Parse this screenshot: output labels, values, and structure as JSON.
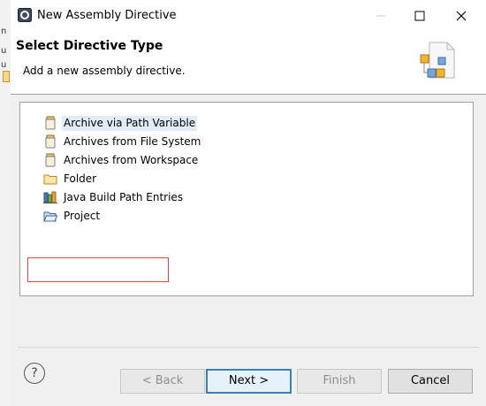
{
  "window": {
    "title": "New Assembly Directive"
  },
  "background_fragments": [
    "n",
    "u",
    "u"
  ],
  "header": {
    "title": "Select Directive Type",
    "description": "Add a new assembly directive."
  },
  "tree": {
    "items": [
      {
        "label": "Archive via Path Variable",
        "icon": "jar-icon",
        "selected": true
      },
      {
        "label": "Archives from File System",
        "icon": "jar-icon",
        "selected": false
      },
      {
        "label": "Archives from Workspace",
        "icon": "jar-icon",
        "selected": false
      },
      {
        "label": "Folder",
        "icon": "folder-icon",
        "selected": false
      },
      {
        "label": "Java Build Path Entries",
        "icon": "library-icon",
        "selected": false
      },
      {
        "label": "Project",
        "icon": "project-folder-icon",
        "selected": false
      }
    ]
  },
  "buttons": {
    "help": "?",
    "back": "< Back",
    "next": "Next >",
    "finish": "Finish",
    "cancel": "Cancel"
  },
  "colors": {
    "annotation": "#e04545",
    "selection": "#e1ecf8",
    "default_button_border": "#3c7fb1"
  }
}
